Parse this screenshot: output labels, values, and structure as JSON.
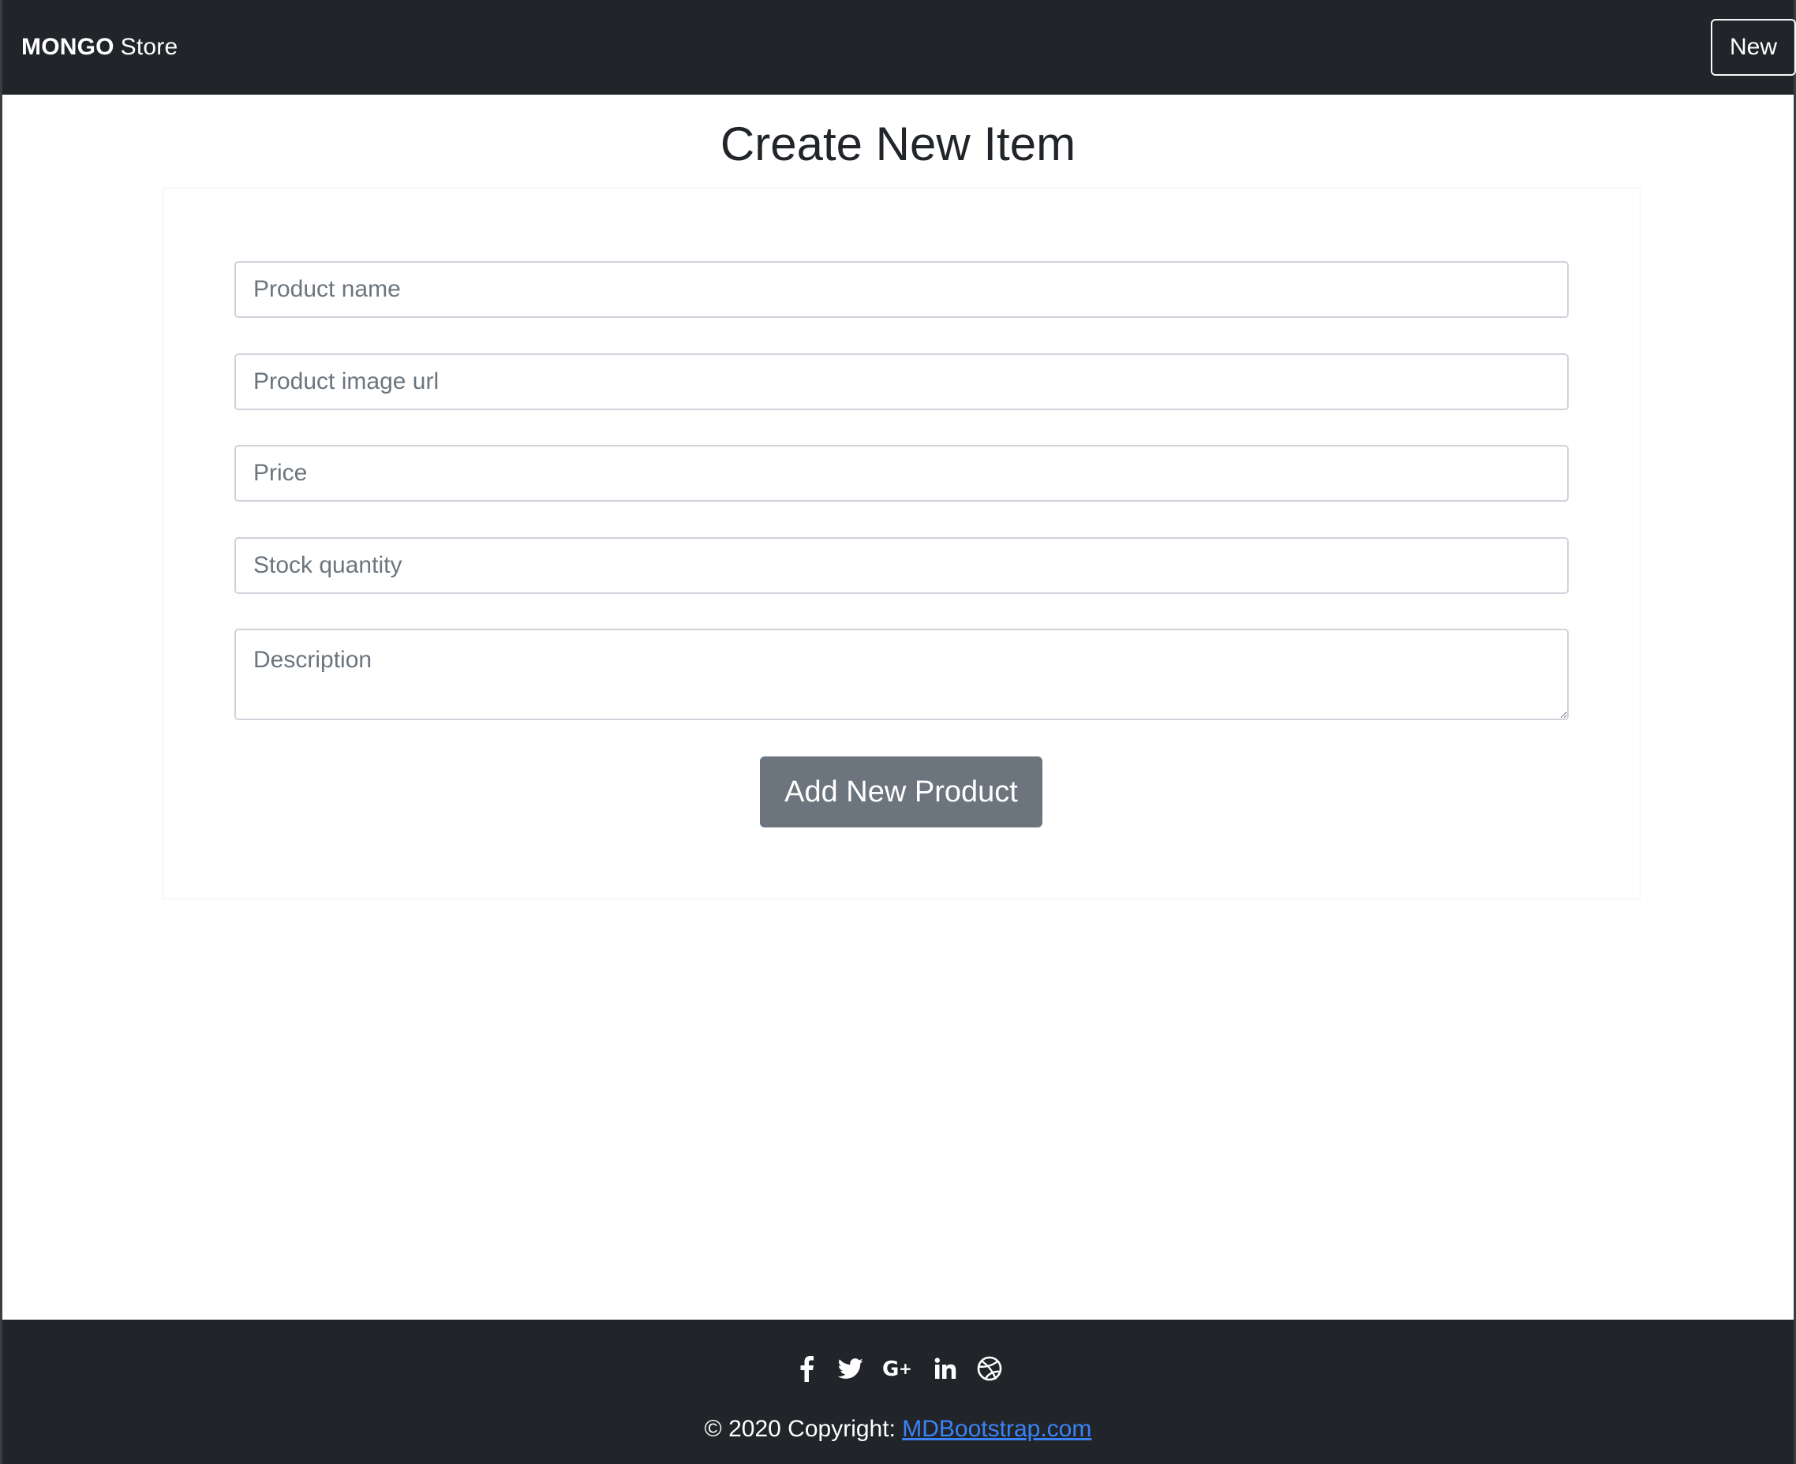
{
  "navbar": {
    "brand_bold": "MONGO",
    "brand_light": "Store",
    "new_button": "New"
  },
  "main": {
    "title": "Create New Item",
    "form": {
      "product_name_placeholder": "Product name",
      "product_image_placeholder": "Product image url",
      "price_placeholder": "Price",
      "stock_placeholder": "Stock quantity",
      "description_placeholder": "Description",
      "submit_label": "Add New Product"
    }
  },
  "footer": {
    "social_icons": [
      "facebook-icon",
      "twitter-icon",
      "google-plus-icon",
      "linkedin-icon",
      "dribbble-icon"
    ],
    "copyright_prefix": "© 2020 Copyright: ",
    "copyright_link": "MDBootstrap.com"
  },
  "colors": {
    "navbar_bg": "#212529",
    "button_secondary": "#6c757d",
    "link": "#3b82f6"
  }
}
